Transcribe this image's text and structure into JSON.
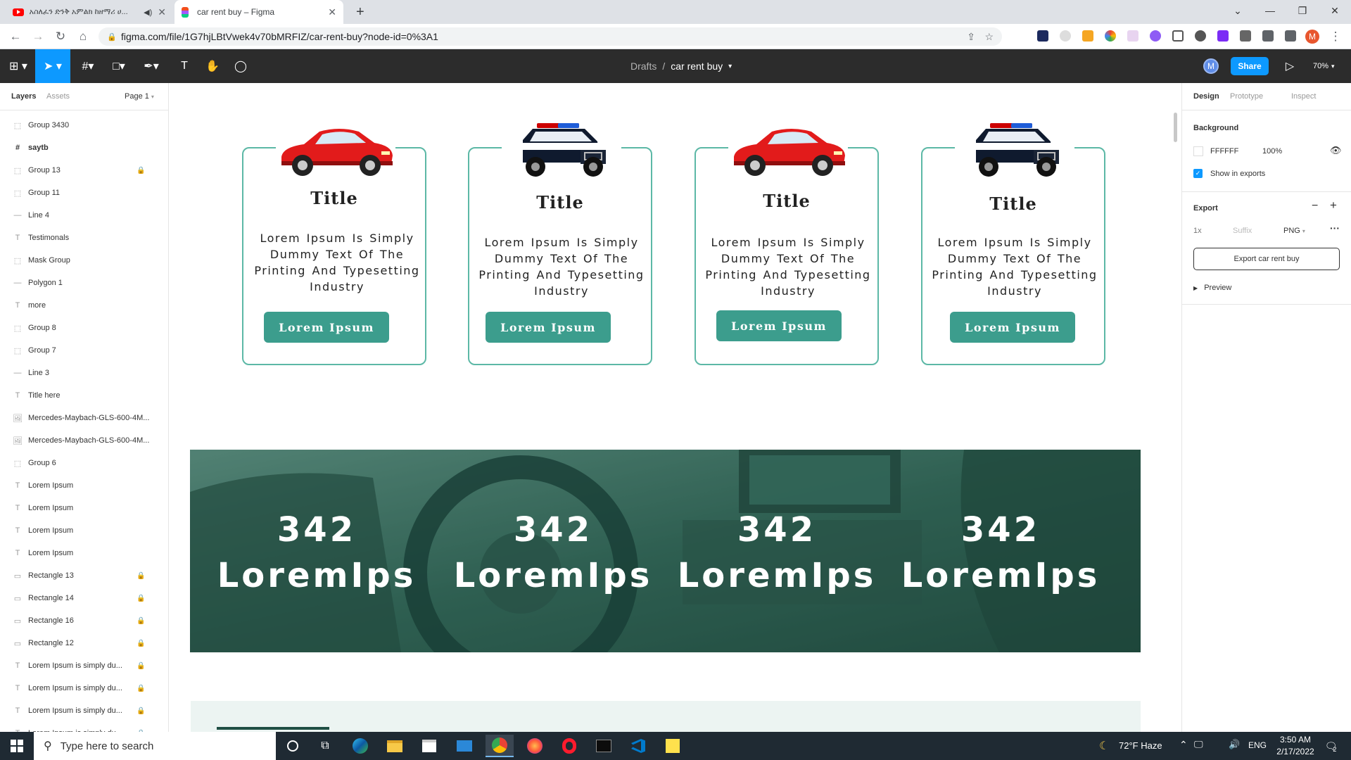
{
  "browser": {
    "tabs": [
      {
        "title": "አስለፈን ድንቅ አምልክ ከዘማሪ ሀ..."
      },
      {
        "title": "car rent buy – Figma"
      }
    ],
    "new_tab": "+",
    "url": "figma.com/file/1G7hjLBtVwek4v70bMRFIZ/car-rent-buy?node-id=0%3A1"
  },
  "figma": {
    "breadcrumb_root": "Drafts",
    "breadcrumb_sep": "/",
    "file_name": "car rent buy",
    "avatar": "M",
    "share_label": "Share",
    "zoom": "70%",
    "left_tabs": {
      "layers": "Layers",
      "assets": "Assets",
      "page": "Page 1"
    },
    "layers": [
      {
        "name": "Group 3430",
        "icon": "group",
        "locked": false
      },
      {
        "name": "saytb",
        "icon": "frame",
        "locked": false
      },
      {
        "name": "Group 13",
        "icon": "group",
        "locked": true
      },
      {
        "name": "Group 11",
        "icon": "group",
        "locked": false
      },
      {
        "name": "Line 4",
        "icon": "line",
        "locked": false
      },
      {
        "name": "Testimonals",
        "icon": "text",
        "locked": false
      },
      {
        "name": "Mask Group",
        "icon": "group",
        "locked": false
      },
      {
        "name": "Polygon 1",
        "icon": "line",
        "locked": false
      },
      {
        "name": "more",
        "icon": "text",
        "locked": false
      },
      {
        "name": "Group 8",
        "icon": "group",
        "locked": false
      },
      {
        "name": "Group 7",
        "icon": "group",
        "locked": false
      },
      {
        "name": "Line 3",
        "icon": "line",
        "locked": false
      },
      {
        "name": "Title here",
        "icon": "text",
        "locked": false
      },
      {
        "name": "Mercedes-Maybach-GLS-600-4M...",
        "icon": "image",
        "locked": false
      },
      {
        "name": "Mercedes-Maybach-GLS-600-4M...",
        "icon": "image",
        "locked": false
      },
      {
        "name": "Group 6",
        "icon": "group",
        "locked": false
      },
      {
        "name": "Lorem Ipsum",
        "icon": "text",
        "locked": false
      },
      {
        "name": "Lorem Ipsum",
        "icon": "text",
        "locked": false
      },
      {
        "name": "Lorem Ipsum",
        "icon": "text",
        "locked": false
      },
      {
        "name": "Lorem Ipsum",
        "icon": "text",
        "locked": false
      },
      {
        "name": "Rectangle 13",
        "icon": "rect",
        "locked": true
      },
      {
        "name": "Rectangle 14",
        "icon": "rect",
        "locked": true
      },
      {
        "name": "Rectangle 16",
        "icon": "rect",
        "locked": true
      },
      {
        "name": "Rectangle 12",
        "icon": "rect",
        "locked": true
      },
      {
        "name": "Lorem Ipsum is simply du...",
        "icon": "text",
        "locked": true
      },
      {
        "name": "Lorem Ipsum is simply du...",
        "icon": "text",
        "locked": true
      },
      {
        "name": "Lorem Ipsum is simply du...",
        "icon": "text",
        "locked": true
      },
      {
        "name": "Lorem Ipsum is simply du...",
        "icon": "text",
        "locked": true
      }
    ],
    "right": {
      "tabs": [
        "Design",
        "Prototype",
        "Inspect"
      ],
      "background_label": "Background",
      "bg_color": "FFFFFF",
      "bg_opacity": "100%",
      "show_in_exports": "Show in exports",
      "export_label": "Export",
      "export_scale": "1x",
      "export_suffix_placeholder": "Suffix",
      "export_format": "PNG",
      "export_button": "Export car rent buy",
      "preview_label": "Preview"
    }
  },
  "design": {
    "cards": [
      {
        "title": "Title",
        "desc": "Lorem Ipsum Is Simply Dummy  Text Of The Printing And  Typesetting Industry",
        "button": "Lorem Ipsum",
        "car": "red-car"
      },
      {
        "title": "Title",
        "desc": "Lorem Ipsum Is Simply Dummy  Text Of The Printing And  Typesetting Industry",
        "button": "Lorem Ipsum",
        "car": "police-car"
      },
      {
        "title": "Title",
        "desc": "Lorem Ipsum Is Simply Dummy  Text Of The Printing And  Typesetting Industry",
        "button": "Lorem Ipsum",
        "car": "red-car"
      },
      {
        "title": "Title",
        "desc": "Lorem Ipsum Is Simply Dummy  Text Of The Printing And  Typesetting Industry",
        "button": "Lorem Ipsum",
        "car": "police-car"
      }
    ],
    "stats": [
      {
        "number": "342",
        "label": "LoremIps"
      },
      {
        "number": "342",
        "label": "LoremIps"
      },
      {
        "number": "342",
        "label": "LoremIps"
      },
      {
        "number": "342",
        "label": "LoremIps"
      }
    ],
    "accent": "#3c9d8d",
    "card_border": "#5cb8a6"
  },
  "taskbar": {
    "search_placeholder": "Type here to search",
    "weather": "72°F  Haze",
    "lang": "ENG",
    "time": "3:50 AM",
    "date": "2/17/2022",
    "notifications": "2"
  },
  "help": "?"
}
